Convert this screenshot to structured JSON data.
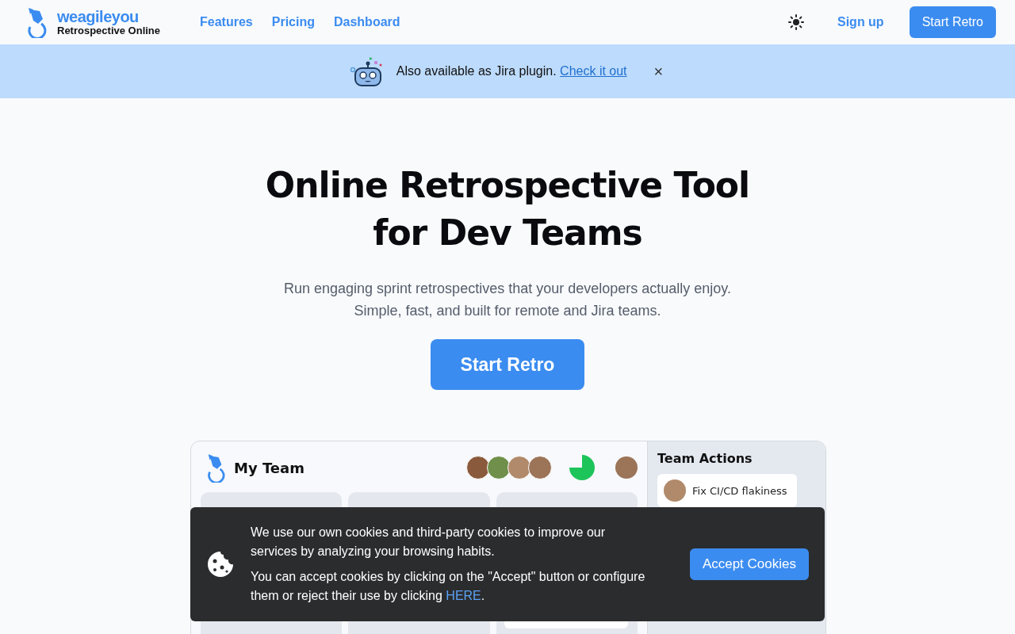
{
  "brand": {
    "name": "weagileyou",
    "tagline": "Retrospective Online"
  },
  "nav": [
    {
      "label": "Features"
    },
    {
      "label": "Pricing"
    },
    {
      "label": "Dashboard"
    }
  ],
  "header_actions": {
    "sign_up": "Sign up",
    "cta": "Start Retro"
  },
  "banner": {
    "text": "Also available as Jira plugin. ",
    "link": "Check it out",
    "close": "×"
  },
  "hero": {
    "title_lines": [
      "Online Retrospective Tool",
      "for Dev Teams"
    ],
    "subtitle_lines": [
      "Run engaging sprint retrospectives that your developers actually enjoy.",
      "Simple, fast, and built for remote and Jira teams."
    ],
    "cta": "Start Retro"
  },
  "preview": {
    "team_name": "My Team",
    "side_title": "Team Actions",
    "actions": [
      {
        "text": "Fix CI/CD flakiness"
      }
    ]
  },
  "cookie": {
    "text1": "We use our own cookies and third-party cookies to improve our services by analyzing your browsing habits.",
    "text2": "You can accept cookies by clicking on the \"Accept\" button or configure them or reject their use by clicking ",
    "link": "HERE",
    "text2_end": ".",
    "button": "Accept Cookies"
  }
}
